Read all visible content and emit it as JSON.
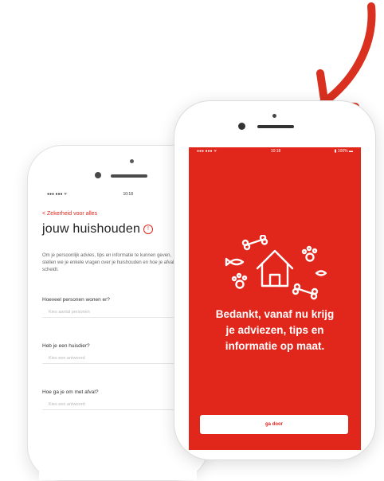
{
  "back_phone": {
    "status_left": "●●● ●●● ᯤ",
    "status_time": "10:18",
    "back_link": "< Zekerheid voor alles",
    "title": "jouw huishouden",
    "info_icon": "info-circle-icon",
    "intro": "Om je persoonlijk advies, tips en informatie te kunnen geven, stellen we je enkele vragen over je huishouden en hoe je afval scheidt.",
    "questions": [
      {
        "label": "Hoeveel personen wonen er?",
        "placeholder": "Kies aantal personen"
      },
      {
        "label": "Heb je een huisdier?",
        "placeholder": "Kies een antwoord"
      },
      {
        "label": "Hoe ga je om met afval?",
        "placeholder": "Kies een antwoord"
      }
    ]
  },
  "front_phone": {
    "status_left": "●●● ●●● ᯤ",
    "status_time": "10:18",
    "status_right": "▮ 100% ▬",
    "illustration": "house-with-pets-icon",
    "message_line1": "Bedankt, vanaf nu krijg",
    "message_line2": "je adviezen, tips en",
    "message_line3": "informatie op maat.",
    "button_label": "ga door"
  },
  "colors": {
    "accent": "#e1261c",
    "arrow": "#d9301f"
  }
}
